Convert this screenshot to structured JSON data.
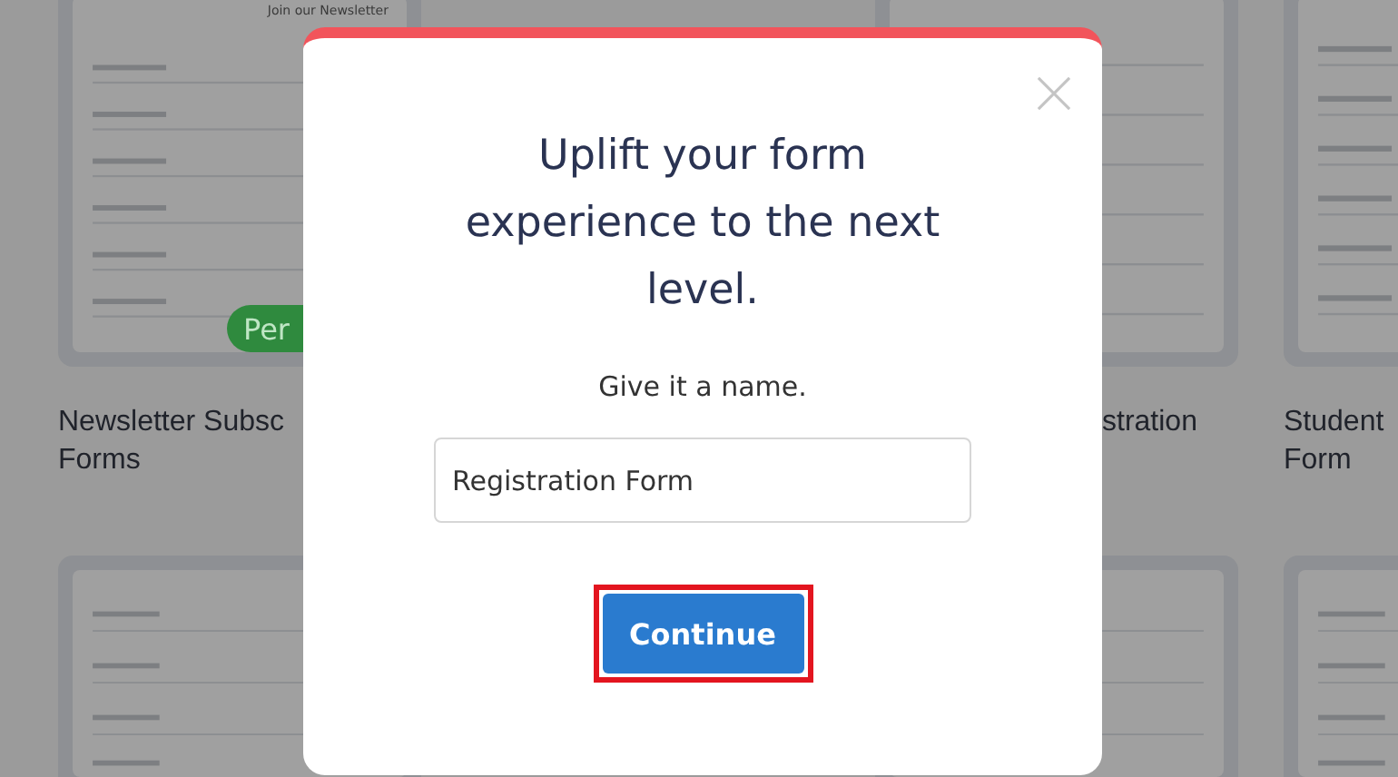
{
  "templates": [
    {
      "title_lines": [
        "Newsletter Subsc",
        "Forms"
      ],
      "heading": "Join our Newsletter",
      "action": "Per"
    },
    {
      "title_lines": [
        "stration"
      ]
    },
    {
      "title_lines": [
        "Student",
        "Form"
      ]
    }
  ],
  "modal": {
    "heading": "Uplift your form experience to the next level.",
    "prompt": "Give it a name.",
    "name_field": {
      "value": "Registration Form"
    },
    "button": "Continue"
  }
}
